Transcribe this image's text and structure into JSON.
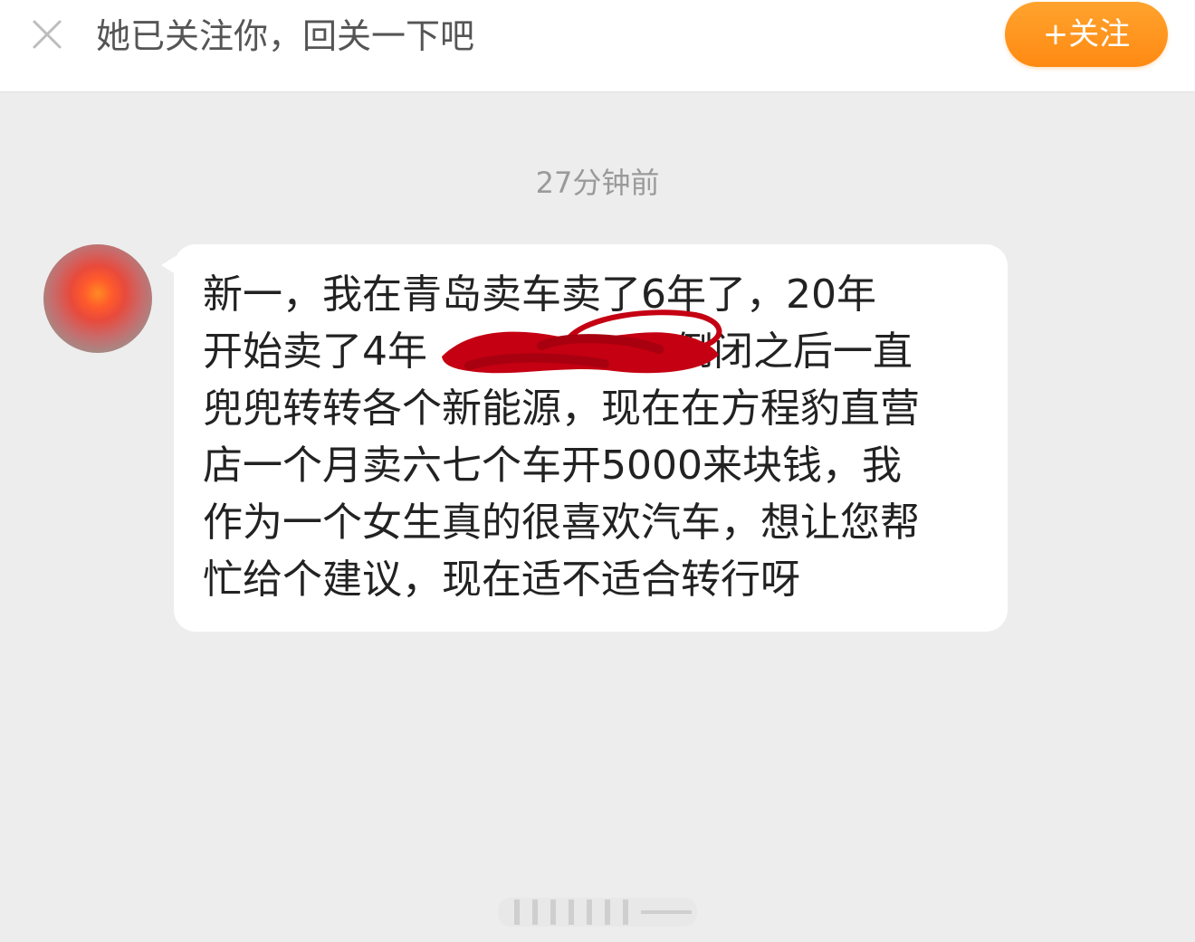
{
  "banner": {
    "text": "她已关注你，回关一下吧",
    "follow_label": "+关注",
    "close_icon": "close-icon"
  },
  "chat": {
    "timestamp": "27分钟前",
    "message_lines": [
      "新一，我在青岛卖车卖了6年了，20年",
      "开始卖了4年",
      "倒闭之后一直",
      "兜兜转转各个新能源，现在在方程豹直营",
      "店一个月卖六七个车开5000来块钱，我",
      "作为一个女生真的很喜欢汽车，想让您帮",
      "忙给个建议，现在适不适合转行呀"
    ],
    "avatar_icon": "avatar",
    "redaction_color": "#c40012"
  },
  "colors": {
    "follow_button": "#ff9a1f",
    "background": "#ededed",
    "bubble": "#ffffff"
  }
}
